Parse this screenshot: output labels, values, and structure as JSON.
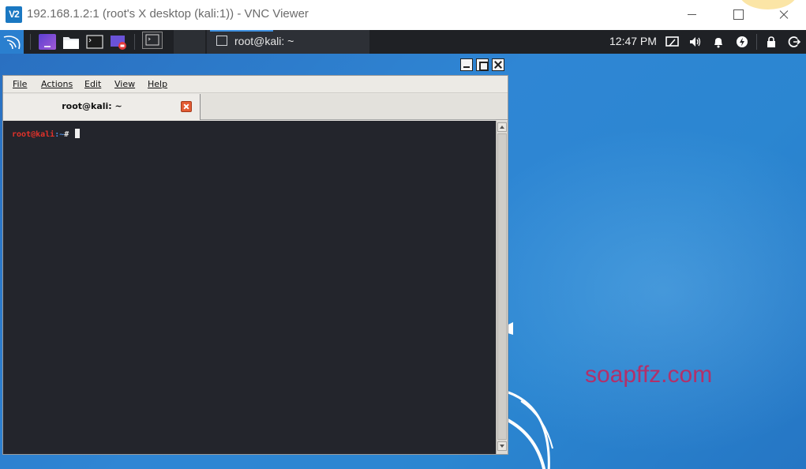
{
  "vnc": {
    "logo_text": "V2",
    "title": "192.168.1.2:1 (root's X desktop (kali:1)) - VNC Viewer"
  },
  "panel": {
    "taskbar_item": "root@kali: ~",
    "clock": "12:47 PM",
    "accent_color": "#2a7fcf"
  },
  "terminal": {
    "menu": {
      "file": "File",
      "actions": "Actions",
      "edit": "Edit",
      "view": "View",
      "help": "Help"
    },
    "tab_label": "root@kali: ~",
    "prompt_user": "root@kali",
    "prompt_path": ":~",
    "prompt_symbol": "# ",
    "background_color": "#23252c"
  },
  "desktop": {
    "watermark": "soapffz.com"
  }
}
